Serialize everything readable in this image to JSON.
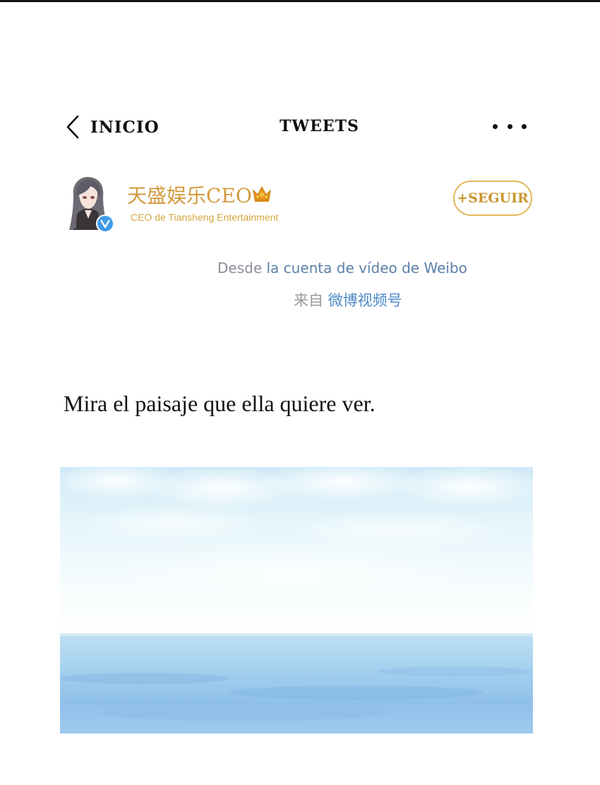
{
  "header": {
    "back_label": "INICIO",
    "title": "TWEETS"
  },
  "profile": {
    "name": "天盛娱乐CEO",
    "bio": "CEO de Tiansheng Entertainment",
    "follow_label": "+SEGUIR",
    "verified": true
  },
  "source": {
    "es_prefix": "Desde ",
    "es_link": "la cuenta de vídeo de Weibo",
    "zh_prefix": "来自 ",
    "zh_link": "微博视频号"
  },
  "post": {
    "text": "Mira el paisaje que ella quiere ver."
  },
  "colors": {
    "accent_gold": "#d29a3e",
    "link_blue": "#4d8ac6",
    "verified_blue": "#3f9be8"
  },
  "icons": {
    "back": "chevron-left-icon",
    "more": "more-dots-icon",
    "crown": "crown-icon",
    "verified": "verified-badge-icon"
  }
}
